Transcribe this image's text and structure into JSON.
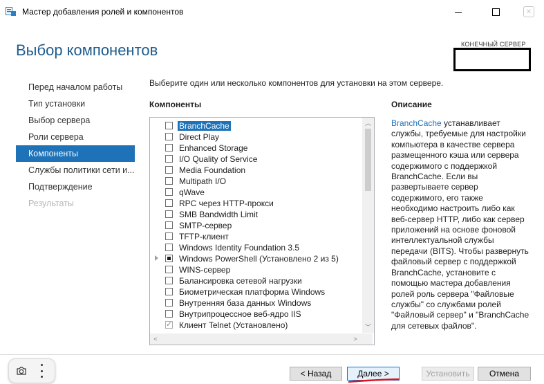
{
  "window": {
    "title": "Мастер добавления ролей и компонентов",
    "icons": {
      "app": "server-manager-icon",
      "minimize": "minimize-icon",
      "maximize": "maximize-icon",
      "close": "close-icon"
    }
  },
  "page": {
    "title": "Выбор компонентов",
    "destination_label": "КОНЕЧНЫЙ СЕРВЕР",
    "instruction": "Выберите один или несколько компонентов для установки на этом сервере."
  },
  "nav": {
    "items": [
      {
        "label": "Перед началом работы",
        "state": "normal"
      },
      {
        "label": "Тип установки",
        "state": "normal"
      },
      {
        "label": "Выбор сервера",
        "state": "normal"
      },
      {
        "label": "Роли сервера",
        "state": "normal"
      },
      {
        "label": "Компоненты",
        "state": "active"
      },
      {
        "label": "Службы политики сети и...",
        "state": "normal"
      },
      {
        "label": "Подтверждение",
        "state": "normal"
      },
      {
        "label": "Результаты",
        "state": "disabled"
      }
    ]
  },
  "components": {
    "header": "Компоненты",
    "items": [
      {
        "label": "BranchCache",
        "state": "unchecked",
        "selected": true,
        "expandable": false
      },
      {
        "label": "Direct Play",
        "state": "unchecked",
        "selected": false,
        "expandable": false
      },
      {
        "label": "Enhanced Storage",
        "state": "unchecked",
        "selected": false,
        "expandable": false
      },
      {
        "label": "I/O Quality of Service",
        "state": "unchecked",
        "selected": false,
        "expandable": false
      },
      {
        "label": "Media Foundation",
        "state": "unchecked",
        "selected": false,
        "expandable": false
      },
      {
        "label": "Multipath I/O",
        "state": "unchecked",
        "selected": false,
        "expandable": false
      },
      {
        "label": "qWave",
        "state": "unchecked",
        "selected": false,
        "expandable": false
      },
      {
        "label": "RPC через HTTP-прокси",
        "state": "unchecked",
        "selected": false,
        "expandable": false
      },
      {
        "label": "SMB Bandwidth Limit",
        "state": "unchecked",
        "selected": false,
        "expandable": false
      },
      {
        "label": "SMTP-сервер",
        "state": "unchecked",
        "selected": false,
        "expandable": false
      },
      {
        "label": "TFTP-клиент",
        "state": "unchecked",
        "selected": false,
        "expandable": false
      },
      {
        "label": "Windows Identity Foundation 3.5",
        "state": "unchecked",
        "selected": false,
        "expandable": false
      },
      {
        "label": "Windows PowerShell (Установлено 2 из 5)",
        "state": "partial",
        "selected": false,
        "expandable": true
      },
      {
        "label": "WINS-сервер",
        "state": "unchecked",
        "selected": false,
        "expandable": false
      },
      {
        "label": "Балансировка сетевой нагрузки",
        "state": "unchecked",
        "selected": false,
        "expandable": false
      },
      {
        "label": "Биометрическая платформа Windows",
        "state": "unchecked",
        "selected": false,
        "expandable": false
      },
      {
        "label": "Внутренняя база данных Windows",
        "state": "unchecked",
        "selected": false,
        "expandable": false
      },
      {
        "label": "Внутрипроцессное веб-ядро IIS",
        "state": "unchecked",
        "selected": false,
        "expandable": false
      },
      {
        "label": "Клиент Telnet (Установлено)",
        "state": "checked",
        "selected": false,
        "expandable": false
      }
    ]
  },
  "description": {
    "header": "Описание",
    "link_text": "BranchCache",
    "body": " устанавливает службы, требуемые для настройки компьютера в качестве сервера размещенного кэша или сервера содержимого с поддержкой BranchCache. Если вы развертываете сервер содержимого, его также необходимо настроить либо как веб-сервер HTTP, либо как сервер приложений на основе фоновой интеллектуальной службы передачи (BITS). Чтобы развернуть файловый сервер с поддержкой BranchCache, установите с помощью мастера добавления ролей роль сервера \"Файловые службы\" со службами ролей \"Файловый сервер\" и \"BranchCache для сетевых файлов\"."
  },
  "buttons": {
    "back": "< Назад",
    "next": "Далее >",
    "install": "Установить",
    "cancel": "Отмена"
  },
  "overlay": {
    "icons": [
      "camera-icon",
      "more-vertical-icon"
    ]
  },
  "colors": {
    "accent": "#1e72b8",
    "title": "#1e5c8e",
    "annotation": "#e0141e"
  }
}
